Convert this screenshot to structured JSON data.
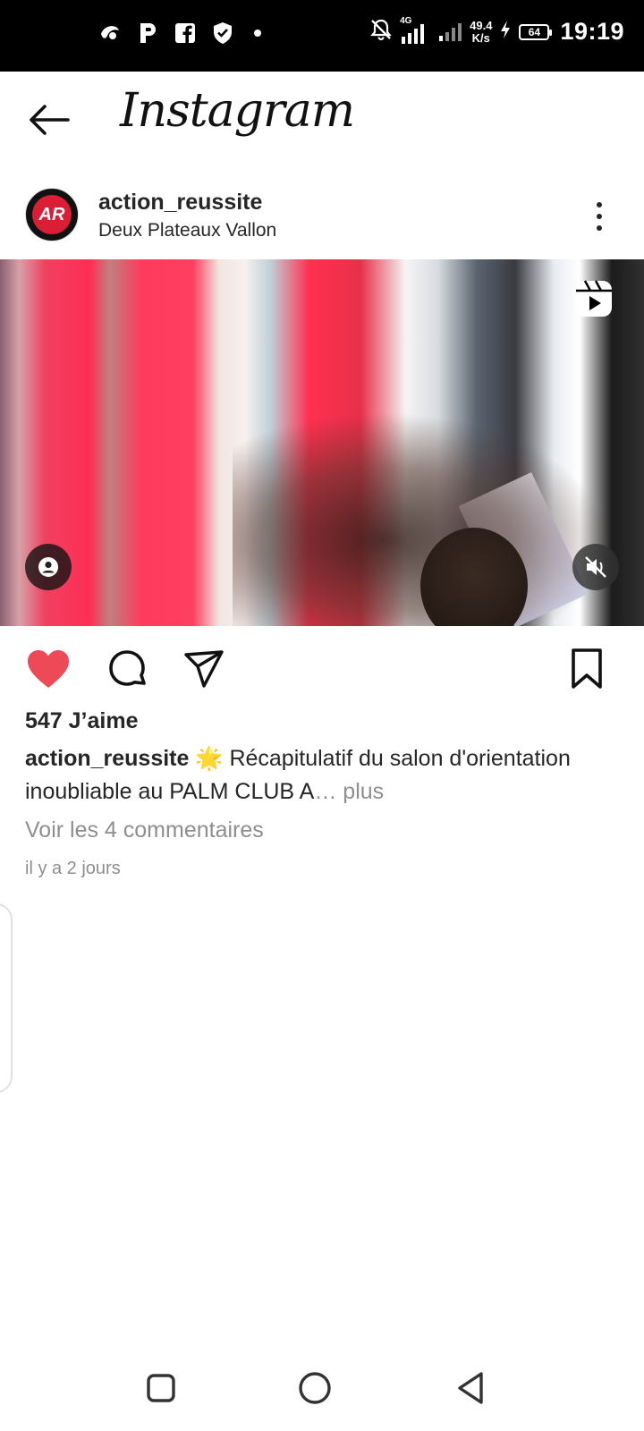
{
  "status_bar": {
    "time": "19:19",
    "network_speed_value": "49.4",
    "network_speed_unit": "K/s",
    "network_type": "4G",
    "battery_level": "64"
  },
  "header": {
    "title": "Instagram"
  },
  "post": {
    "username": "action_reussite",
    "location": "Deux Plateaux Vallon",
    "avatar_text": "AR",
    "likes": "547 J’aime",
    "caption_user": "action_reussite",
    "caption_text": " 🌟 Récapitulatif du salon d'orientation inoubliable au PALM CLUB A",
    "caption_ellipsis": "…",
    "caption_more": " plus",
    "comments_link": "Voir les 4 commentaires",
    "timestamp": "il y a 2 jours"
  },
  "colors": {
    "like_red": "#ed4956",
    "text": "#262626",
    "muted": "#8e8e8e"
  },
  "icons": {
    "back": "arrow-left-icon",
    "more": "more-vertical-icon",
    "reels": "reels-icon",
    "user_tag": "user-icon",
    "mute": "volume-off-icon",
    "like": "heart-filled-icon",
    "comment": "comment-icon",
    "share": "paper-plane-icon",
    "save": "bookmark-icon"
  }
}
